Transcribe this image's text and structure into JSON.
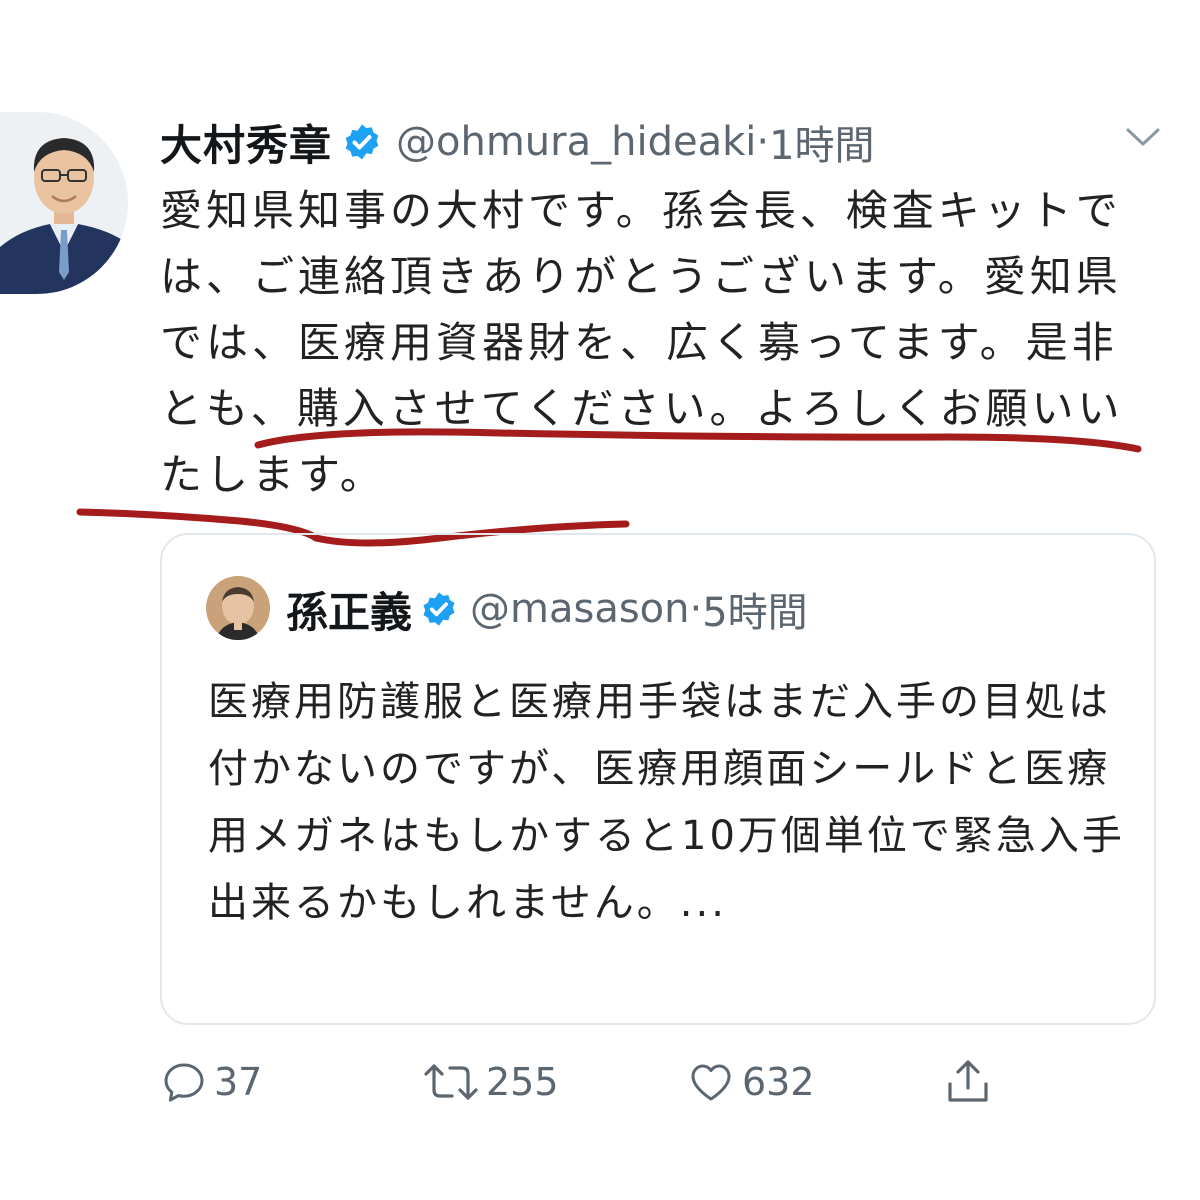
{
  "tweet": {
    "display_name": "大村秀章",
    "handle": "@ohmura_hideaki",
    "time": "1時間",
    "text": "愛知県知事の大村です。孫会長、検査キットでは、ご連絡頂きありがとうございます。愛知県では、医療用資器財を、広く募ってます。是非とも、購入させてください。よろしくお願いいたします。"
  },
  "quoted": {
    "display_name": "孫正義",
    "handle": "@masason",
    "time": "5時間",
    "text": "医療用防護服と医療用手袋はまだ入手の目処は付かないのですが、医療用顔面シールドと医療用メガネはもしかすると10万個単位で緊急入手出来るかもしれません。..."
  },
  "actions": {
    "replies": "37",
    "retweets": "255",
    "likes": "632"
  },
  "colors": {
    "verified": "#1da1f2",
    "underline": "#a51c1c",
    "icon": "#5b6670"
  },
  "icons": [
    "verified-badge-icon",
    "chevron-down-icon",
    "reply-icon",
    "retweet-icon",
    "like-icon",
    "share-icon"
  ]
}
